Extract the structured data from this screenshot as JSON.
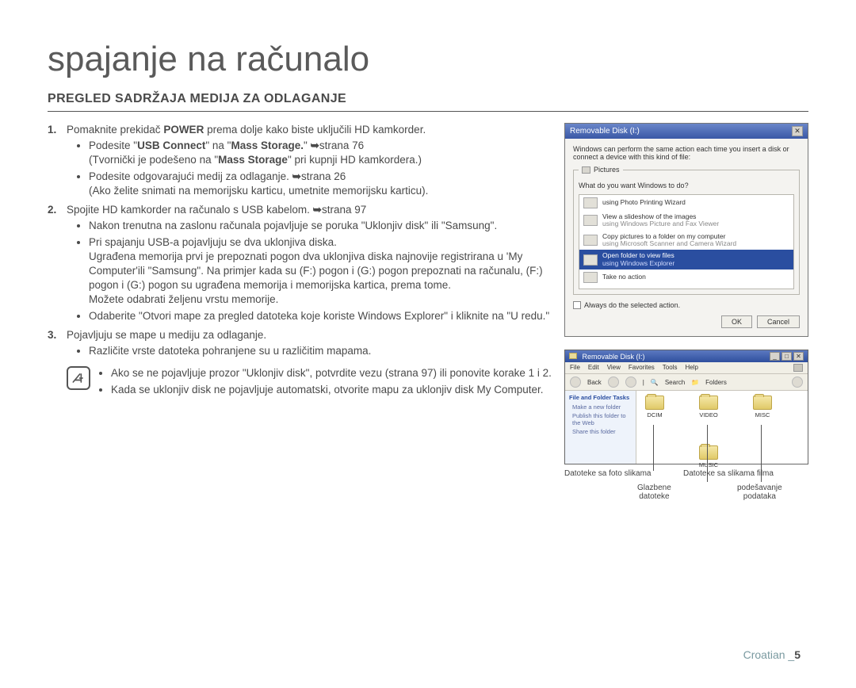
{
  "page": {
    "title": "spajanje na računalo",
    "heading": "PREGLED SADRŽAJA MEDIJA ZA ODLAGANJE",
    "footer_lang": "Croatian _",
    "footer_page": "5"
  },
  "steps": {
    "s1": {
      "num": "1.",
      "lead_a": "Pomaknite prekidač ",
      "lead_b": "POWER",
      "lead_c": " prema dolje kako biste uključili HD kamkorder.",
      "b1_a": "Podesite \"",
      "b1_b": "USB Connect",
      "b1_c": "\" na \"",
      "b1_d": "Mass Storage.",
      "b1_e": "\" ",
      "b1_f": "➥",
      "b1_g": "strana 76",
      "b1_h": "(Tvornički je podešeno na \"",
      "b1_i": "Mass Storage",
      "b1_j": "\" pri kupnji HD kamkordera.)",
      "b2_a": "Podesite odgovarajući medij za odlaganje. ",
      "b2_b": "➥",
      "b2_c": "strana 26",
      "b2_d": "(Ako želite snimati na memorijsku karticu, umetnite memorijsku karticu)."
    },
    "s2": {
      "num": "2.",
      "lead_a": "Spojite HD kamkorder na računalo s USB kabelom. ",
      "lead_b": "➥",
      "lead_c": "strana 97",
      "b1": "Nakon trenutna na zaslonu računala pojavljuje se poruka \"Uklonjiv disk\" ili \"Samsung\".",
      "b2_a": "Pri spajanju USB-a pojavljuju se dva uklonjiva diska.",
      "b2_b": "Ugrađena memorija prvi je prepoznati pogon dva uklonjiva diska najnovije registrirana u 'My Computer'ili \"Samsung\". Na primjer kada su (F:) pogon i (G:) pogon prepoznati na računalu, (F:) pogon i (G:) pogon su ugrađena memorija i memorijska kartica, prema tome.",
      "b2_c": "Možete odabrati željenu vrstu memorije.",
      "b3": "Odaberite \"Otvori mape za pregled datoteka koje koriste Windows Explorer\" i kliknite na \"U redu.\""
    },
    "s3": {
      "num": "3.",
      "lead": "Pojavljuju se mape u mediju za odlaganje.",
      "b1": "Različite vrste datoteka pohranjene su u različitim mapama."
    }
  },
  "notes": {
    "n1": "Ako se ne pojavljuje prozor \"Uklonjiv disk\", potvrdite vezu (strana 97) ili ponovite korake 1 i 2.",
    "n2": "Kada se uklonjiv disk ne pojavljuje automatski, otvorite mapu za uklonjiv disk My Computer."
  },
  "dialog": {
    "title": "Removable Disk (I:)",
    "prompt": "Windows can perform the same action each time you insert a disk or connect a device with this kind of file:",
    "legend": "Pictures",
    "question": "What do you want Windows to do?",
    "opt1_t1": "using Photo Printing Wizard",
    "opt2_t1": "View a slideshow of the images",
    "opt2_t2": "using Windows Picture and Fax Viewer",
    "opt3_t1": "Copy pictures to a folder on my computer",
    "opt3_t2": "using Microsoft Scanner and Camera Wizard",
    "opt4_t1": "Open folder to view files",
    "opt4_t2": "using Windows Explorer",
    "opt5_t1": "Take no action",
    "checkbox": "Always do the selected action.",
    "ok": "OK",
    "cancel": "Cancel"
  },
  "explorer": {
    "title": "Removable Disk (I:)",
    "menu": {
      "file": "File",
      "edit": "Edit",
      "view": "View",
      "fav": "Favorites",
      "tools": "Tools",
      "help": "Help"
    },
    "toolbar": {
      "back": "Back",
      "search": "Search",
      "folders": "Folders"
    },
    "side_h": "File and Folder Tasks",
    "side_i1": "Make a new folder",
    "side_i2": "Publish this folder to the Web",
    "side_i3": "Share this folder",
    "folders": {
      "dcim": "DCIM",
      "video": "VIDEO",
      "misc": "MISC",
      "music": "MUSIC"
    }
  },
  "callouts": {
    "photo": "Datoteke sa foto slikama",
    "film": "Datoteke sa slikama filma",
    "music1": "Glazbene",
    "music2": "datoteke",
    "misc1": "podešavanje",
    "misc2": "podataka"
  }
}
